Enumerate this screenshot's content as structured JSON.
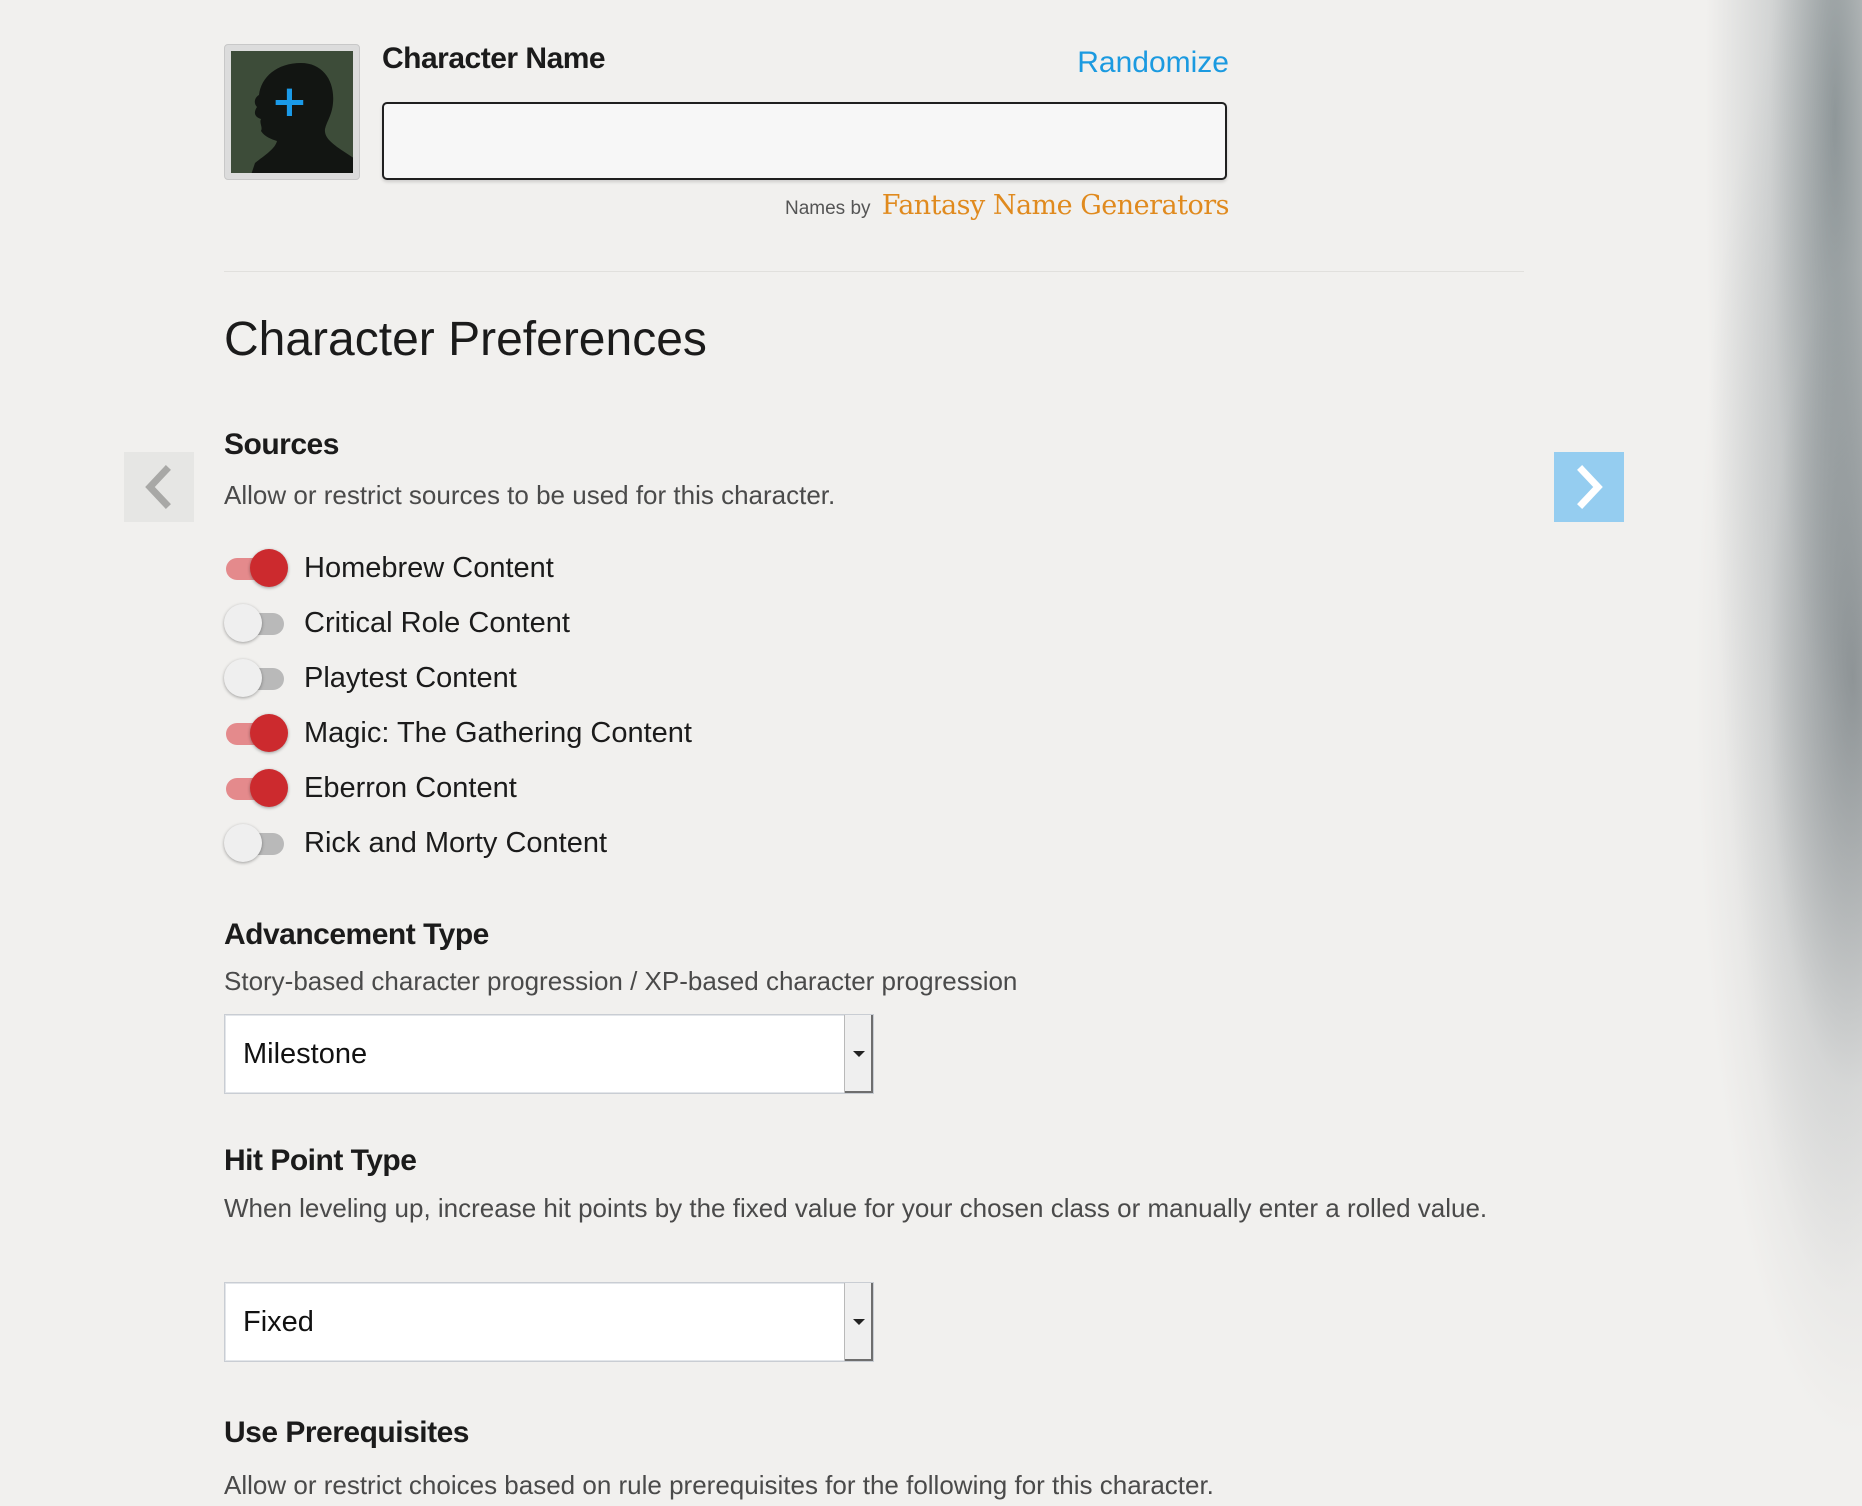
{
  "header": {
    "name_label": "Character Name",
    "randomize_label": "Randomize",
    "name_value": "",
    "names_by_prefix": "Names by",
    "names_by_brand": "Fantasy Name Generators"
  },
  "preferences": {
    "title": "Character Preferences",
    "sources": {
      "title": "Sources",
      "description": "Allow or restrict sources to be used for this character.",
      "items": [
        {
          "label": "Homebrew Content",
          "enabled": true
        },
        {
          "label": "Critical Role Content",
          "enabled": false
        },
        {
          "label": "Playtest Content",
          "enabled": false
        },
        {
          "label": "Magic: The Gathering Content",
          "enabled": true
        },
        {
          "label": "Eberron Content",
          "enabled": true
        },
        {
          "label": "Rick and Morty Content",
          "enabled": false
        }
      ]
    },
    "advancement": {
      "title": "Advancement Type",
      "description": "Story-based character progression / XP-based character progression",
      "selected": "Milestone"
    },
    "hit_points": {
      "title": "Hit Point Type",
      "description": "When leveling up, increase hit points by the fixed value for your chosen class or manually enter a rolled value.",
      "selected": "Fixed"
    },
    "prerequisites": {
      "title": "Use Prerequisites",
      "description": "Allow or restrict choices based on rule prerequisites for the following for this character."
    }
  },
  "nav": {
    "prev_icon": "chevron-left-icon",
    "next_icon": "chevron-right-icon"
  },
  "colors": {
    "accent_blue": "#1b9ae0",
    "toggle_on": "#cc2a2e",
    "toggle_off": "#efefef",
    "next_button": "#95cdf0"
  }
}
